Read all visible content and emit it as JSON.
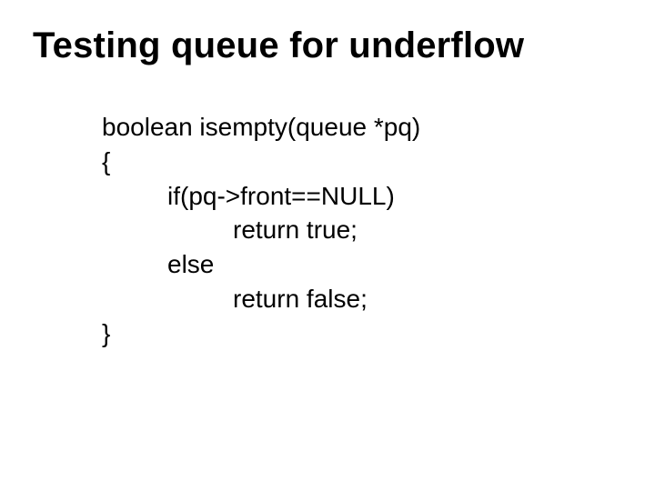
{
  "title": "Testing queue for underflow",
  "code": {
    "line1": "boolean isempty(queue *pq)",
    "line2": "{",
    "line3": "if(pq->front==NULL)",
    "line4": "return true;",
    "line5": "else",
    "line6": "return false;",
    "line7": "}"
  }
}
